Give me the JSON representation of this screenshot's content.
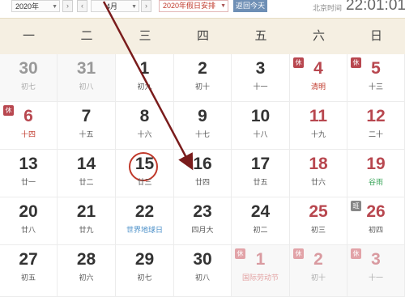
{
  "toolbar": {
    "year_select": "2020年",
    "month_select": "4月",
    "holiday_select": "2020年假日安排",
    "today_button": "返回今天",
    "location_label": "北京时间",
    "time": "22:01:01"
  },
  "weekdays": [
    "一",
    "二",
    "三",
    "四",
    "五",
    "六",
    "日"
  ],
  "weeks": [
    [
      {
        "day": "30",
        "sub": "初七",
        "other": true,
        "weekend": false,
        "tag": "",
        "subtype": ""
      },
      {
        "day": "31",
        "sub": "初八",
        "other": true,
        "weekend": false,
        "tag": "",
        "subtype": ""
      },
      {
        "day": "1",
        "sub": "初九",
        "other": false,
        "weekend": false,
        "tag": "",
        "subtype": ""
      },
      {
        "day": "2",
        "sub": "初十",
        "other": false,
        "weekend": false,
        "tag": "",
        "subtype": ""
      },
      {
        "day": "3",
        "sub": "十一",
        "other": false,
        "weekend": false,
        "tag": "",
        "subtype": ""
      },
      {
        "day": "4",
        "sub": "清明",
        "other": false,
        "weekend": true,
        "tag": "休",
        "subtype": "holiday"
      },
      {
        "day": "5",
        "sub": "十三",
        "other": false,
        "weekend": true,
        "tag": "休",
        "subtype": ""
      }
    ],
    [
      {
        "day": "6",
        "sub": "十四",
        "other": false,
        "weekend": true,
        "tag": "休",
        "subtype": "holiday"
      },
      {
        "day": "7",
        "sub": "十五",
        "other": false,
        "weekend": false,
        "tag": "",
        "subtype": ""
      },
      {
        "day": "8",
        "sub": "十六",
        "other": false,
        "weekend": false,
        "tag": "",
        "subtype": ""
      },
      {
        "day": "9",
        "sub": "十七",
        "other": false,
        "weekend": false,
        "tag": "",
        "subtype": ""
      },
      {
        "day": "10",
        "sub": "十八",
        "other": false,
        "weekend": false,
        "tag": "",
        "subtype": ""
      },
      {
        "day": "11",
        "sub": "十九",
        "other": false,
        "weekend": true,
        "tag": "",
        "subtype": ""
      },
      {
        "day": "12",
        "sub": "二十",
        "other": false,
        "weekend": true,
        "tag": "",
        "subtype": ""
      }
    ],
    [
      {
        "day": "13",
        "sub": "廿一",
        "other": false,
        "weekend": false,
        "tag": "",
        "subtype": ""
      },
      {
        "day": "14",
        "sub": "廿二",
        "other": false,
        "weekend": false,
        "tag": "",
        "subtype": ""
      },
      {
        "day": "15",
        "sub": "廿三",
        "other": false,
        "weekend": false,
        "tag": "",
        "subtype": "",
        "today": true
      },
      {
        "day": "16",
        "sub": "廿四",
        "other": false,
        "weekend": false,
        "tag": "",
        "subtype": ""
      },
      {
        "day": "17",
        "sub": "廿五",
        "other": false,
        "weekend": false,
        "tag": "",
        "subtype": ""
      },
      {
        "day": "18",
        "sub": "廿六",
        "other": false,
        "weekend": true,
        "tag": "",
        "subtype": ""
      },
      {
        "day": "19",
        "sub": "谷雨",
        "other": false,
        "weekend": true,
        "tag": "",
        "subtype": "solarterm"
      }
    ],
    [
      {
        "day": "20",
        "sub": "廿八",
        "other": false,
        "weekend": false,
        "tag": "",
        "subtype": ""
      },
      {
        "day": "21",
        "sub": "廿九",
        "other": false,
        "weekend": false,
        "tag": "",
        "subtype": ""
      },
      {
        "day": "22",
        "sub": "世界地球日",
        "other": false,
        "weekend": false,
        "tag": "",
        "subtype": "festival"
      },
      {
        "day": "23",
        "sub": "四月大",
        "other": false,
        "weekend": false,
        "tag": "",
        "subtype": ""
      },
      {
        "day": "24",
        "sub": "初二",
        "other": false,
        "weekend": false,
        "tag": "",
        "subtype": ""
      },
      {
        "day": "25",
        "sub": "初三",
        "other": false,
        "weekend": true,
        "tag": "",
        "subtype": ""
      },
      {
        "day": "26",
        "sub": "初四",
        "other": false,
        "weekend": true,
        "tag": "班",
        "subtype": ""
      }
    ],
    [
      {
        "day": "27",
        "sub": "初五",
        "other": false,
        "weekend": false,
        "tag": "",
        "subtype": ""
      },
      {
        "day": "28",
        "sub": "初六",
        "other": false,
        "weekend": false,
        "tag": "",
        "subtype": ""
      },
      {
        "day": "29",
        "sub": "初七",
        "other": false,
        "weekend": false,
        "tag": "",
        "subtype": ""
      },
      {
        "day": "30",
        "sub": "初八",
        "other": false,
        "weekend": false,
        "tag": "",
        "subtype": ""
      },
      {
        "day": "1",
        "sub": "国际劳动节",
        "other": true,
        "weekend": true,
        "tag": "休",
        "subtype": "holiday"
      },
      {
        "day": "2",
        "sub": "初十",
        "other": true,
        "weekend": true,
        "tag": "休",
        "subtype": ""
      },
      {
        "day": "3",
        "sub": "十一",
        "other": true,
        "weekend": true,
        "tag": "休",
        "subtype": ""
      }
    ]
  ],
  "colors": {
    "accent": "#b8474f",
    "header_bg": "#f5efe2",
    "today_button": "#6e8fb5",
    "arrow": "#7a1c1c"
  }
}
